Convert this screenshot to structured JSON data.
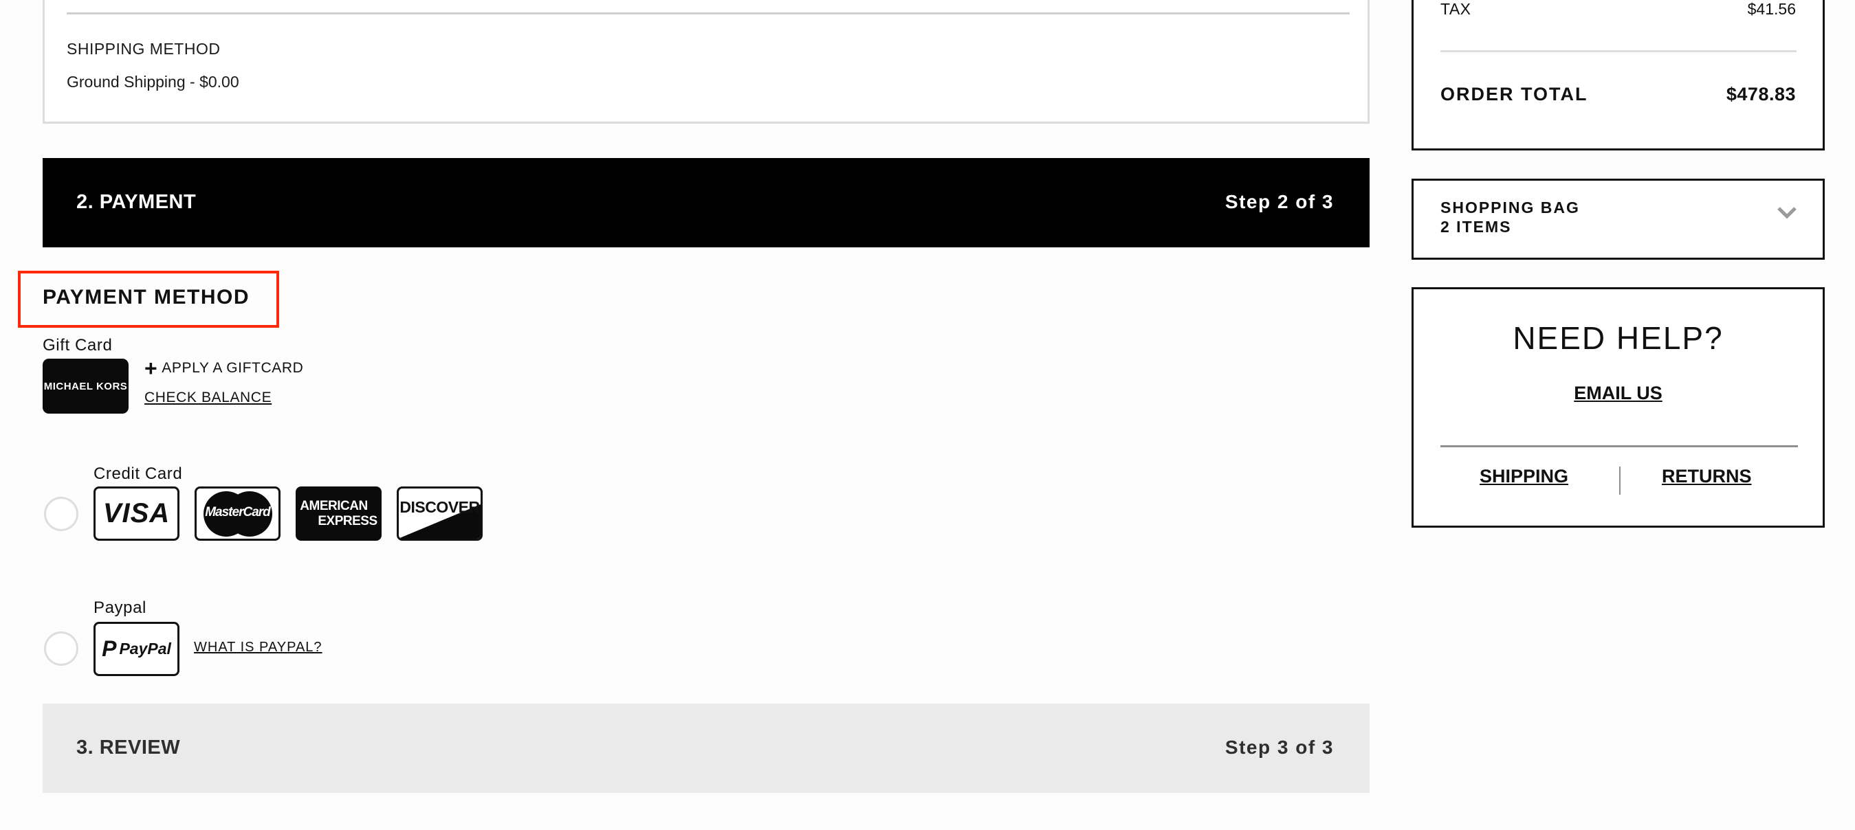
{
  "shipping": {
    "method_label": "SHIPPING METHOD",
    "method_value": "Ground Shipping - $0.00"
  },
  "payment_step": {
    "title": "2. PAYMENT",
    "step": "Step 2 of 3",
    "section_heading": "PAYMENT METHOD",
    "highlight_color": "#ff2a0a",
    "gift_card": {
      "label": "Gift Card",
      "card_brand": "MICHAEL KORS",
      "apply_label": "APPLY A GIFTCARD",
      "apply_icon": "plus-icon",
      "check_balance_label": "CHECK BALANCE"
    },
    "credit_card": {
      "label": "Credit Card",
      "selected": false,
      "brands": [
        {
          "name": "visa",
          "text": "VISA"
        },
        {
          "name": "mastercard",
          "text": "MasterCard"
        },
        {
          "name": "amex",
          "text_line1": "AMERICAN",
          "text_line2": "EXPRESS"
        },
        {
          "name": "discover",
          "text": "DISCOVER"
        }
      ]
    },
    "paypal": {
      "label": "Paypal",
      "selected": false,
      "logo_mark": "P",
      "logo_text": "PayPal",
      "what_is_label": "WHAT IS PAYPAL?"
    }
  },
  "review_step": {
    "title": "3. REVIEW",
    "step": "Step 3 of 3"
  },
  "order_summary": {
    "tax_label": "TAX",
    "tax_value": "$41.56",
    "total_label": "ORDER TOTAL",
    "total_value": "$478.83"
  },
  "shopping_bag": {
    "title": "SHOPPING BAG",
    "items": "2 ITEMS",
    "toggle_icon": "chevron-down-icon"
  },
  "help": {
    "title": "NEED HELP?",
    "email_label": "EMAIL US",
    "shipping_label": "SHIPPING",
    "returns_label": "RETURNS"
  }
}
